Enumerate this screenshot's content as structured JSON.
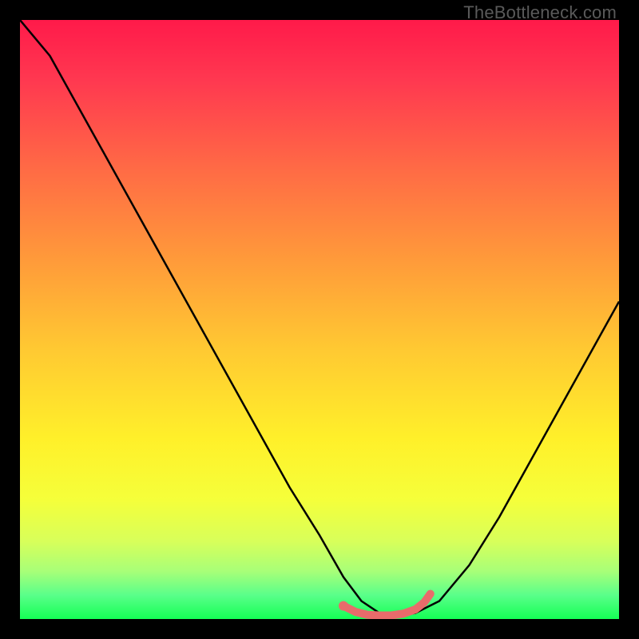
{
  "watermark": "TheBottleneck.com",
  "chart_data": {
    "type": "line",
    "title": "",
    "xlabel": "",
    "ylabel": "",
    "xlim": [
      0,
      100
    ],
    "ylim": [
      0,
      100
    ],
    "series": [
      {
        "name": "bottleneck-curve",
        "x": [
          0,
          5,
          10,
          15,
          20,
          25,
          30,
          35,
          40,
          45,
          50,
          54,
          57,
          60,
          63,
          66,
          70,
          75,
          80,
          85,
          90,
          95,
          100
        ],
        "y": [
          100,
          94,
          85,
          76,
          67,
          58,
          49,
          40,
          31,
          22,
          14,
          7,
          3,
          1,
          0.5,
          1,
          3,
          9,
          17,
          26,
          35,
          44,
          53
        ],
        "color": "#000000"
      },
      {
        "name": "optimal-band",
        "x": [
          54,
          56,
          58,
          60,
          62,
          64,
          66,
          67.5,
          68.5
        ],
        "y": [
          2.2,
          1.2,
          0.7,
          0.6,
          0.6,
          0.9,
          1.6,
          2.8,
          4.2
        ],
        "color": "#e86b6b"
      }
    ],
    "annotations": [],
    "background_gradient": {
      "top": "#ff1a4a",
      "bottom": "#15ff55",
      "meaning": "bottleneck-severity-heatmap"
    }
  }
}
